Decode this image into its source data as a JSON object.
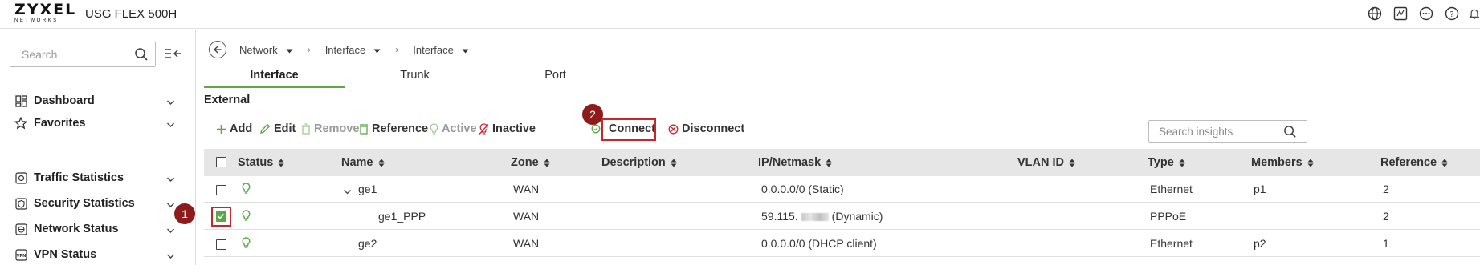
{
  "app": {
    "logo_text": "ZYXEL",
    "logo_subtext": "NETWORKS",
    "product": "USG FLEX 500H",
    "top_icons": [
      "globe-icon",
      "terminal-icon",
      "more-icon",
      "help-icon",
      "bell-icon"
    ]
  },
  "sidebar": {
    "search_placeholder": "Search",
    "items": [
      {
        "label": "Dashboard",
        "icon": "dashboard-icon"
      },
      {
        "label": "Favorites",
        "icon": "star-icon"
      },
      {
        "label": "Traffic Statistics",
        "icon": "traffic-icon"
      },
      {
        "label": "Security Statistics",
        "icon": "security-icon"
      },
      {
        "label": "Network Status",
        "icon": "network-icon"
      },
      {
        "label": "VPN Status",
        "icon": "vpn-icon"
      }
    ]
  },
  "breadcrumb": [
    "Network",
    "Interface",
    "Interface"
  ],
  "tabs": [
    {
      "label": "Interface",
      "active": true
    },
    {
      "label": "Trunk",
      "active": false
    },
    {
      "label": "Port",
      "active": false
    }
  ],
  "section_title": "External",
  "toolbar": {
    "add": "Add",
    "edit": "Edit",
    "remove": "Remove",
    "reference": "Reference",
    "active": "Active",
    "inactive": "Inactive",
    "connect": "Connect",
    "disconnect": "Disconnect",
    "search_placeholder": "Search insights"
  },
  "callouts": {
    "checkbox_step": "1",
    "connect_step": "2"
  },
  "table": {
    "headers": [
      "Status",
      "Name",
      "Zone",
      "Description",
      "IP/Netmask",
      "VLAN ID",
      "Type",
      "Members",
      "Reference"
    ],
    "rows": [
      {
        "name": "ge1",
        "zone": "WAN",
        "description": "",
        "ip": "0.0.0.0/0 (Static)",
        "vlan": "",
        "type": "Ethernet",
        "members": "p1",
        "reference": "2",
        "checked": false,
        "expandable": true
      },
      {
        "name": "ge1_PPP",
        "zone": "WAN",
        "description": "",
        "ip_prefix": "59.115.",
        "ip_suffix": "(Dynamic)",
        "vlan": "",
        "type": "PPPoE",
        "members": "",
        "reference": "2",
        "checked": true
      },
      {
        "name": "ge2",
        "zone": "WAN",
        "description": "",
        "ip": "0.0.0.0/0 (DHCP client)",
        "vlan": "",
        "type": "Ethernet",
        "members": "p2",
        "reference": "1",
        "checked": false
      }
    ]
  },
  "colors": {
    "accent_green": "#5aa846",
    "highlight_red": "#c9252d",
    "badge_red": "#8d1b1b",
    "header_gray": "#e6e6e6"
  }
}
